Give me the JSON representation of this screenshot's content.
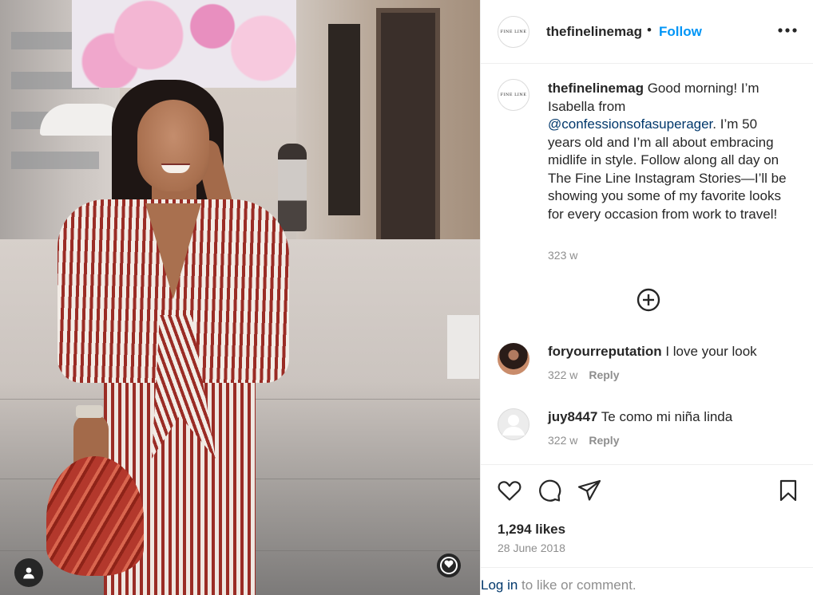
{
  "post": {
    "username": "thefinelinemag",
    "separator": "•",
    "follow_label": "Follow",
    "brand_avatar_text": "FINE LINE",
    "caption": {
      "username": "thefinelinemag",
      "text_before_mention": " Good morning! I’m Isabella from ",
      "mention": "@confessionsofasuperager",
      "text_after_mention": ". I’m 50 years old and I’m all about embracing midlife in style. Follow along all day on The Fine Line Instagram Stories—I’ll be showing you some of my favorite looks for every occasion from work to travel!",
      "time": "323 w"
    },
    "comments": [
      {
        "username": "foryourreputation",
        "text": " I love your look",
        "time": "322 w",
        "reply_label": "Reply"
      },
      {
        "username": "juy8447",
        "text": " Te como mi niña linda",
        "time": "322 w",
        "reply_label": "Reply"
      }
    ],
    "likes": "1,294 likes",
    "date": "28 June 2018",
    "login_link": "Log in",
    "login_suffix": " to like or comment."
  },
  "icons": {
    "more": "more-horizontal-icon",
    "load_more": "plus-circle-icon",
    "like": "heart-icon",
    "comment": "comment-bubble-icon",
    "share": "paper-plane-icon",
    "save": "bookmark-icon",
    "tagged_user": "user-icon",
    "reel": "reel-badge-icon"
  },
  "colors": {
    "follow_blue": "#0095f6",
    "link_dark_blue": "#00376b",
    "meta_grey": "#8e8e8e",
    "text": "#262626"
  }
}
